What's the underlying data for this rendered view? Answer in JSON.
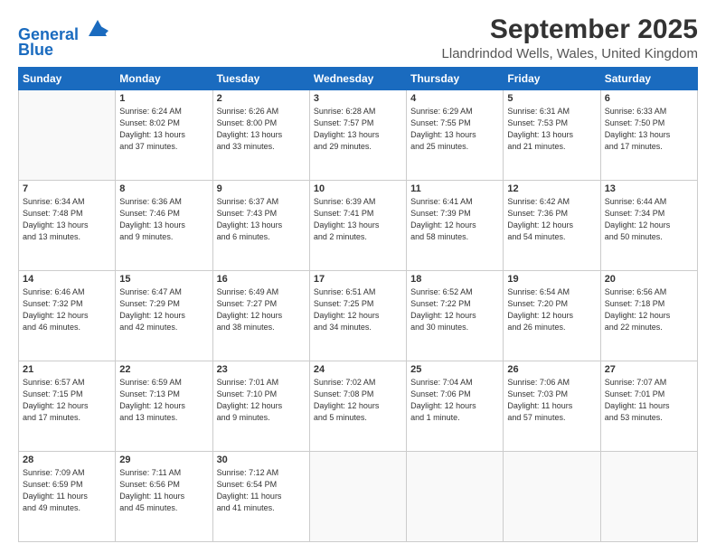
{
  "header": {
    "logo_line1": "General",
    "logo_line2": "Blue",
    "title": "September 2025",
    "subtitle": "Llandrindod Wells, Wales, United Kingdom"
  },
  "days_of_week": [
    "Sunday",
    "Monday",
    "Tuesday",
    "Wednesday",
    "Thursday",
    "Friday",
    "Saturday"
  ],
  "weeks": [
    [
      {
        "num": "",
        "info": ""
      },
      {
        "num": "1",
        "info": "Sunrise: 6:24 AM\nSunset: 8:02 PM\nDaylight: 13 hours\nand 37 minutes."
      },
      {
        "num": "2",
        "info": "Sunrise: 6:26 AM\nSunset: 8:00 PM\nDaylight: 13 hours\nand 33 minutes."
      },
      {
        "num": "3",
        "info": "Sunrise: 6:28 AM\nSunset: 7:57 PM\nDaylight: 13 hours\nand 29 minutes."
      },
      {
        "num": "4",
        "info": "Sunrise: 6:29 AM\nSunset: 7:55 PM\nDaylight: 13 hours\nand 25 minutes."
      },
      {
        "num": "5",
        "info": "Sunrise: 6:31 AM\nSunset: 7:53 PM\nDaylight: 13 hours\nand 21 minutes."
      },
      {
        "num": "6",
        "info": "Sunrise: 6:33 AM\nSunset: 7:50 PM\nDaylight: 13 hours\nand 17 minutes."
      }
    ],
    [
      {
        "num": "7",
        "info": "Sunrise: 6:34 AM\nSunset: 7:48 PM\nDaylight: 13 hours\nand 13 minutes."
      },
      {
        "num": "8",
        "info": "Sunrise: 6:36 AM\nSunset: 7:46 PM\nDaylight: 13 hours\nand 9 minutes."
      },
      {
        "num": "9",
        "info": "Sunrise: 6:37 AM\nSunset: 7:43 PM\nDaylight: 13 hours\nand 6 minutes."
      },
      {
        "num": "10",
        "info": "Sunrise: 6:39 AM\nSunset: 7:41 PM\nDaylight: 13 hours\nand 2 minutes."
      },
      {
        "num": "11",
        "info": "Sunrise: 6:41 AM\nSunset: 7:39 PM\nDaylight: 12 hours\nand 58 minutes."
      },
      {
        "num": "12",
        "info": "Sunrise: 6:42 AM\nSunset: 7:36 PM\nDaylight: 12 hours\nand 54 minutes."
      },
      {
        "num": "13",
        "info": "Sunrise: 6:44 AM\nSunset: 7:34 PM\nDaylight: 12 hours\nand 50 minutes."
      }
    ],
    [
      {
        "num": "14",
        "info": "Sunrise: 6:46 AM\nSunset: 7:32 PM\nDaylight: 12 hours\nand 46 minutes."
      },
      {
        "num": "15",
        "info": "Sunrise: 6:47 AM\nSunset: 7:29 PM\nDaylight: 12 hours\nand 42 minutes."
      },
      {
        "num": "16",
        "info": "Sunrise: 6:49 AM\nSunset: 7:27 PM\nDaylight: 12 hours\nand 38 minutes."
      },
      {
        "num": "17",
        "info": "Sunrise: 6:51 AM\nSunset: 7:25 PM\nDaylight: 12 hours\nand 34 minutes."
      },
      {
        "num": "18",
        "info": "Sunrise: 6:52 AM\nSunset: 7:22 PM\nDaylight: 12 hours\nand 30 minutes."
      },
      {
        "num": "19",
        "info": "Sunrise: 6:54 AM\nSunset: 7:20 PM\nDaylight: 12 hours\nand 26 minutes."
      },
      {
        "num": "20",
        "info": "Sunrise: 6:56 AM\nSunset: 7:18 PM\nDaylight: 12 hours\nand 22 minutes."
      }
    ],
    [
      {
        "num": "21",
        "info": "Sunrise: 6:57 AM\nSunset: 7:15 PM\nDaylight: 12 hours\nand 17 minutes."
      },
      {
        "num": "22",
        "info": "Sunrise: 6:59 AM\nSunset: 7:13 PM\nDaylight: 12 hours\nand 13 minutes."
      },
      {
        "num": "23",
        "info": "Sunrise: 7:01 AM\nSunset: 7:10 PM\nDaylight: 12 hours\nand 9 minutes."
      },
      {
        "num": "24",
        "info": "Sunrise: 7:02 AM\nSunset: 7:08 PM\nDaylight: 12 hours\nand 5 minutes."
      },
      {
        "num": "25",
        "info": "Sunrise: 7:04 AM\nSunset: 7:06 PM\nDaylight: 12 hours\nand 1 minute."
      },
      {
        "num": "26",
        "info": "Sunrise: 7:06 AM\nSunset: 7:03 PM\nDaylight: 11 hours\nand 57 minutes."
      },
      {
        "num": "27",
        "info": "Sunrise: 7:07 AM\nSunset: 7:01 PM\nDaylight: 11 hours\nand 53 minutes."
      }
    ],
    [
      {
        "num": "28",
        "info": "Sunrise: 7:09 AM\nSunset: 6:59 PM\nDaylight: 11 hours\nand 49 minutes."
      },
      {
        "num": "29",
        "info": "Sunrise: 7:11 AM\nSunset: 6:56 PM\nDaylight: 11 hours\nand 45 minutes."
      },
      {
        "num": "30",
        "info": "Sunrise: 7:12 AM\nSunset: 6:54 PM\nDaylight: 11 hours\nand 41 minutes."
      },
      {
        "num": "",
        "info": ""
      },
      {
        "num": "",
        "info": ""
      },
      {
        "num": "",
        "info": ""
      },
      {
        "num": "",
        "info": ""
      }
    ]
  ]
}
